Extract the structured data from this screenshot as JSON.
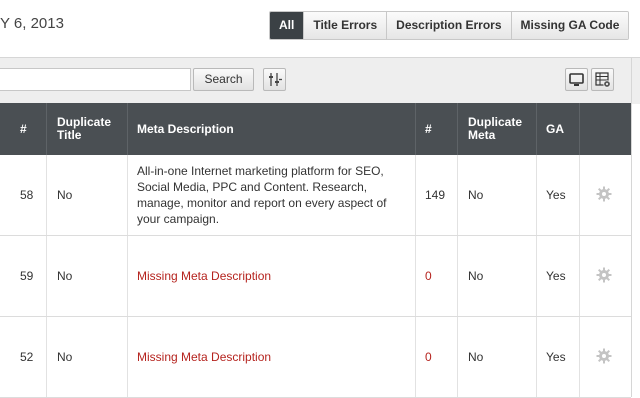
{
  "header": {
    "date_text": "Y 6, 2013"
  },
  "filters": [
    {
      "label": "All",
      "active": true
    },
    {
      "label": "Title Errors",
      "active": false
    },
    {
      "label": "Description Errors",
      "active": false
    },
    {
      "label": "Missing GA Code",
      "active": false
    }
  ],
  "toolbar": {
    "search_value": "",
    "search_button": "Search",
    "icons": [
      "column-adjust-icon",
      "monitor-icon",
      "table-settings-icon"
    ]
  },
  "columns": [
    "#",
    "Duplicate Title",
    "Meta Description",
    "#",
    "Duplicate Meta",
    "GA"
  ],
  "rows": [
    {
      "title_count": "58",
      "duplicate_title": "No",
      "meta_description": "All-in-one Internet marketing platform for SEO, Social Media, PPC and Content. Research, manage, monitor and report on every aspect of your campaign.",
      "meta_missing": false,
      "meta_count": "149",
      "duplicate_meta": "No",
      "ga": "Yes"
    },
    {
      "title_count": "59",
      "duplicate_title": "No",
      "meta_description": "Missing Meta Description",
      "meta_missing": true,
      "meta_count": "0",
      "duplicate_meta": "No",
      "ga": "Yes"
    },
    {
      "title_count": "52",
      "duplicate_title": "No",
      "meta_description": "Missing Meta Description",
      "meta_missing": true,
      "meta_count": "0",
      "duplicate_meta": "No",
      "ga": "Yes"
    }
  ],
  "colors": {
    "header_bg": "#4a4f53",
    "active_filter": "#3b4145",
    "error_text": "#b5231e"
  }
}
